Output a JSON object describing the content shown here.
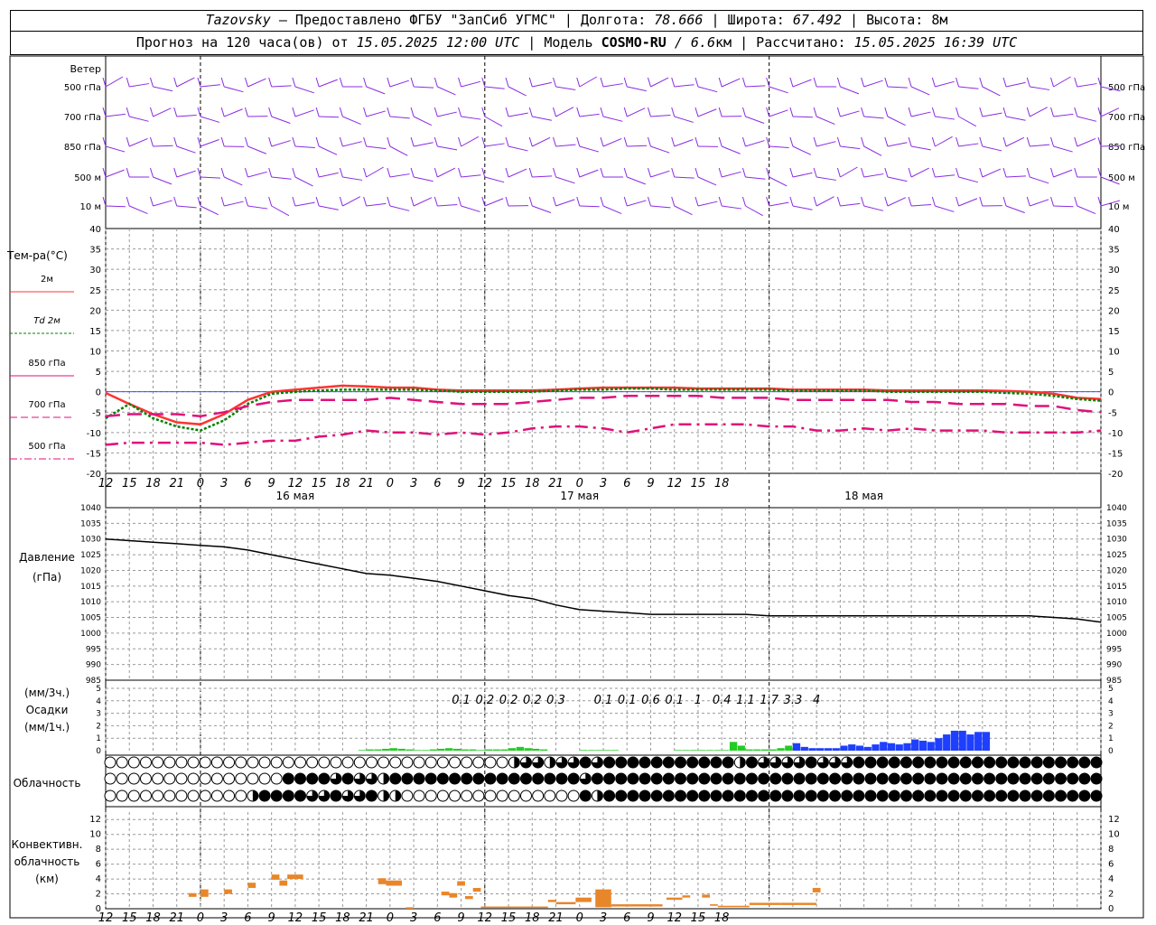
{
  "header": {
    "station": "Tazovsky",
    "provider": " — Предоставлено ФГБУ \"ЗапСиб УГМС\" | Долгота: ",
    "lon": "78.666",
    "lat_label": " | Широта: ",
    "lat": "67.492",
    "alt_label": " | Высота: 8м",
    "forecast_label": "Прогноз на 120 часа(ов) от ",
    "forecast_time": "15.05.2025 12:00 UTC",
    "model_label": "  | Модель ",
    "model": "COSMO-RU",
    "resolution": " / 6.6",
    "km": "км | Рассчитано: ",
    "calc_time": "15.05.2025 16:39 UTC"
  },
  "colors": {
    "wind": "#8a2be2",
    "t2m": "#ff3333",
    "td2m": "#008000",
    "t850": "#e0107a",
    "t700": "#e0107a",
    "t500": "#e0107a",
    "pressure": "#000000",
    "precip_light": "#22cc22",
    "precip_heavy": "#1f3fff",
    "conv": "#e8862a",
    "zero_line": "#3333ff"
  },
  "wind_panel": {
    "title": "Ветер",
    "levels": [
      "500 гПа",
      "700 гПа",
      "850 гПа",
      "500 м",
      "10 м"
    ]
  },
  "temp_panel": {
    "title": "Тем-ра(°C)",
    "legend": [
      {
        "label": "2м",
        "style": "solid"
      },
      {
        "label": "Td  2м",
        "style": "dotted"
      },
      {
        "label": "850 гПа",
        "style": "solid-thin"
      },
      {
        "label": "700 гПа",
        "style": "dashed"
      },
      {
        "label": "500 гПа",
        "style": "dashdot"
      }
    ]
  },
  "pressure_panel": {
    "title_line1": "Давление",
    "title_line2": "(гПа)"
  },
  "precip_panel": {
    "title_line1": "(мм/3ч.)",
    "title_line2": "Осадки",
    "title_line3": "(мм/1ч.)"
  },
  "cloud_panel": {
    "title": "Облачность"
  },
  "conv_panel": {
    "title_line1": "Конвективн.",
    "title_line2": "облачность",
    "title_line3": "(км)"
  },
  "chart_data": [
    {
      "type": "line",
      "title": "Тем-ра(°C)",
      "x_hours": [
        0,
        3,
        6,
        9,
        12,
        15,
        18,
        21,
        24,
        27,
        30,
        33,
        36,
        39,
        42,
        45,
        48,
        51,
        54,
        57,
        60,
        63,
        66,
        69,
        72,
        75,
        78,
        81,
        84,
        87,
        90,
        93,
        96,
        99,
        102,
        105,
        108,
        111,
        114,
        117,
        120,
        123,
        126
      ],
      "x_tick_labels": [
        "12",
        "15",
        "18",
        "21",
        "0",
        "3",
        "6",
        "9",
        "12",
        "15",
        "18",
        "21",
        "0",
        "3",
        "6",
        "9",
        "12",
        "15",
        "18",
        "21",
        "0",
        "3",
        "6",
        "9",
        "12",
        "15",
        "18"
      ],
      "day_labels": [
        "16 мая",
        "17 мая",
        "18 мая"
      ],
      "ylim": [
        -20,
        40
      ],
      "y_ticks": [
        -20,
        -15,
        -10,
        -5,
        0,
        5,
        10,
        15,
        20,
        25,
        30,
        35,
        40
      ],
      "series": [
        {
          "name": "2м",
          "values": [
            -0.3,
            -3,
            -5.5,
            -7.5,
            -8,
            -5.5,
            -2,
            0,
            0.5,
            1,
            1.5,
            1.3,
            1,
            1,
            0.5,
            0.3,
            0.3,
            0.3,
            0.3,
            0.5,
            0.8,
            1,
            1,
            1,
            1,
            0.8,
            0.8,
            0.8,
            0.8,
            0.5,
            0.5,
            0.5,
            0.5,
            0.3,
            0.3,
            0.3,
            0.3,
            0.3,
            0.2,
            0,
            -0.5,
            -1.5,
            -1.8
          ]
        },
        {
          "name": "Td  2м",
          "values": [
            -6.5,
            -3,
            -6.5,
            -8.5,
            -9.5,
            -7,
            -3,
            -0.5,
            0,
            0.3,
            0.5,
            0.5,
            0.5,
            0.5,
            0.3,
            0,
            0,
            0,
            0,
            0.3,
            0.5,
            0.5,
            0.8,
            0.8,
            0.5,
            0.5,
            0.5,
            0.5,
            0.5,
            0.3,
            0.3,
            0.3,
            0.3,
            0,
            0,
            0,
            0,
            0,
            -0.3,
            -0.5,
            -1,
            -1.8,
            -2.2
          ]
        },
        {
          "name": "700 гПа",
          "values": [
            -6,
            -5.5,
            -5.5,
            -5.5,
            -6,
            -5,
            -3.5,
            -2.5,
            -2,
            -2,
            -2,
            -2,
            -1.5,
            -2,
            -2.5,
            -3,
            -3,
            -3,
            -2.5,
            -2,
            -1.5,
            -1.5,
            -1,
            -1,
            -1,
            -1,
            -1.5,
            -1.5,
            -1.5,
            -2,
            -2,
            -2,
            -2,
            -2,
            -2.5,
            -2.5,
            -3,
            -3,
            -3,
            -3.5,
            -3.5,
            -4.5,
            -5
          ]
        },
        {
          "name": "500 гПа",
          "values": [
            -13,
            -12.5,
            -12.5,
            -12.5,
            -12.5,
            -13,
            -12.5,
            -12,
            -12,
            -11,
            -10.5,
            -9.5,
            -10,
            -10,
            -10.5,
            -10,
            -10.5,
            -10,
            -9,
            -8.5,
            -8.5,
            -9,
            -10,
            -9,
            -8,
            -8,
            -8,
            -8,
            -8.5,
            -8.5,
            -9.5,
            -9.5,
            -9,
            -9.5,
            -9,
            -9.5,
            -9.5,
            -9.5,
            -10,
            -10,
            -10,
            -10,
            -9.5
          ]
        }
      ]
    },
    {
      "type": "line",
      "title": "Давление",
      "ylabel": "(гПа)",
      "ylim": [
        985,
        1040
      ],
      "y_ticks": [
        985,
        990,
        995,
        1000,
        1005,
        1010,
        1015,
        1020,
        1025,
        1030,
        1035,
        1040
      ],
      "x_hours": [
        0,
        3,
        6,
        9,
        12,
        15,
        18,
        21,
        24,
        27,
        30,
        33,
        36,
        39,
        42,
        45,
        48,
        51,
        54,
        57,
        60,
        63,
        66,
        69,
        72,
        75,
        78,
        81,
        84,
        87,
        90,
        93,
        96,
        99,
        102,
        105,
        108,
        111,
        114,
        117,
        120,
        123,
        126
      ],
      "series": [
        {
          "name": "",
          "values": [
            1030,
            1029.5,
            1029,
            1028.5,
            1028,
            1027.5,
            1026.5,
            1025,
            1023.5,
            1022,
            1020.5,
            1019,
            1018.5,
            1017.5,
            1016.5,
            1015,
            1013.5,
            1012,
            1011,
            1009,
            1007.5,
            1007,
            1006.5,
            1006,
            1006,
            1006,
            1006,
            1006,
            1005.5,
            1005.5,
            1005.5,
            1005.5,
            1005.5,
            1005.5,
            1005.5,
            1005.5,
            1005.5,
            1005.5,
            1005.5,
            1005.5,
            1005,
            1004.5,
            1003.5
          ]
        }
      ]
    },
    {
      "type": "bar",
      "title": "Осадки",
      "ylabel": "(мм/1ч.)",
      "ylim": [
        0,
        5
      ],
      "y_ticks": [
        0,
        1,
        2,
        3,
        4,
        5
      ],
      "label_3h_hours": [
        45,
        48,
        51,
        54,
        57,
        60,
        63,
        66,
        69,
        72,
        75,
        78,
        81,
        84,
        87,
        90,
        93
      ],
      "label_3h": [
        "0.1",
        "0.2",
        "0.2",
        "0.2",
        "0.3",
        "0.1",
        "0.1",
        "0.6",
        "0.1",
        "1",
        "0.4",
        "1.1",
        "1.7",
        "3.3",
        "4"
      ],
      "label_3h_positions": [
        45,
        48,
        51,
        54,
        57,
        63,
        66,
        69,
        72,
        75,
        78,
        81,
        84,
        87,
        90
      ],
      "hourly_start_hour": 32,
      "hourly_values": [
        0.05,
        0.1,
        0.1,
        0.15,
        0.2,
        0.15,
        0.1,
        0.05,
        0.05,
        0.1,
        0.15,
        0.2,
        0.15,
        0.1,
        0.1,
        0.05,
        0.1,
        0.1,
        0.1,
        0.2,
        0.3,
        0.2,
        0.15,
        0.1,
        0,
        0,
        0,
        0,
        0.05,
        0.05,
        0.05,
        0.05,
        0.05,
        0,
        0,
        0,
        0,
        0,
        0,
        0,
        0.05,
        0.05,
        0.05,
        0.05,
        0.05,
        0.05,
        0.05,
        0.7,
        0.4,
        0.1,
        0.1,
        0.1,
        0.1,
        0.2,
        0.4,
        0.6,
        0.3,
        0.2,
        0.2,
        0.2,
        0.2,
        0.4,
        0.5,
        0.4,
        0.3,
        0.5,
        0.7,
        0.6,
        0.5,
        0.6,
        0.9,
        0.8,
        0.7,
        1,
        1.3,
        1.6,
        1.6,
        1.3,
        1.5,
        1.5
      ],
      "heavy_threshold_hour": 87
    },
    {
      "type": "table",
      "title": "Облачность",
      "rows": 3,
      "cols": 43,
      "cover_row_high": [
        0,
        0,
        0,
        0,
        0,
        0,
        0,
        0,
        0,
        0,
        0,
        0,
        0,
        0,
        0,
        0,
        0,
        0,
        0,
        0,
        0,
        0,
        0,
        0,
        0,
        0,
        0,
        0,
        0,
        0,
        0,
        0,
        0,
        0,
        2,
        3,
        3,
        2,
        3,
        3,
        4,
        3,
        4,
        4,
        4,
        4,
        4,
        4,
        4,
        4,
        4,
        4,
        4,
        2,
        4,
        3,
        3,
        3,
        3,
        4,
        3,
        3,
        3,
        4,
        4,
        4,
        4,
        4,
        4,
        4,
        4,
        4,
        4,
        4,
        4,
        4,
        4,
        4,
        4,
        4,
        4,
        4,
        4,
        4,
        4,
        4,
        4,
        4,
        4,
        4,
        4,
        4,
        4,
        4,
        4,
        4,
        4,
        4,
        4,
        4,
        4,
        4,
        4,
        4,
        4,
        4,
        4,
        4,
        4,
        4,
        4,
        4,
        4,
        4,
        4,
        4,
        4,
        4,
        4,
        4,
        4,
        4,
        4,
        4,
        4,
        4,
        4,
        4,
        4
      ],
      "cover_row_mid_note": "0=clear,1=1/4,2=1/2,3=3/4,4=overcast",
      "cover_row_mid": [
        0,
        0,
        0,
        0,
        0,
        0,
        0,
        0,
        0,
        0,
        0,
        0,
        0,
        0,
        0,
        4,
        4,
        4,
        4,
        3,
        4,
        3,
        3,
        2,
        4,
        4,
        4,
        4,
        4,
        4,
        4,
        4,
        4,
        4,
        4,
        4,
        4,
        4,
        4,
        4,
        3,
        4,
        4,
        4,
        4,
        4,
        4,
        4,
        4,
        4,
        4,
        4,
        4,
        4,
        4,
        4,
        4,
        4,
        4,
        4,
        4,
        4,
        4,
        4,
        4,
        4,
        4,
        4,
        4,
        4,
        4,
        4,
        4,
        4,
        4,
        4,
        4,
        4,
        4,
        4,
        4,
        4,
        4,
        4,
        4,
        4,
        4,
        4,
        4,
        4
      ],
      "cover_row_low": [
        0,
        0,
        0,
        0,
        0,
        0,
        0,
        0,
        0,
        0,
        0,
        0,
        2,
        4,
        4,
        4,
        4,
        3,
        3,
        4,
        3,
        3,
        4,
        2,
        2,
        0,
        0,
        0,
        0,
        0,
        0,
        0,
        0,
        0,
        0,
        0,
        0,
        0,
        0,
        0,
        4,
        2,
        4,
        4,
        4,
        4,
        4,
        4,
        4,
        4,
        4,
        4,
        4,
        4,
        4,
        4,
        4,
        4,
        4,
        4,
        4,
        4,
        4,
        4,
        4,
        4,
        4,
        4,
        4,
        4,
        4,
        4,
        4,
        4,
        4,
        4,
        4,
        4,
        4,
        4,
        4,
        4,
        4,
        4,
        4,
        4,
        4,
        4,
        4,
        4
      ]
    },
    {
      "type": "bar",
      "title": "Конвективн. облачность",
      "ylabel": "(км)",
      "ylim": [
        0,
        13
      ],
      "y_ticks": [
        0,
        2,
        4,
        6,
        8,
        10,
        12
      ],
      "segments": [
        {
          "start": 10.5,
          "end": 11.5,
          "base": 1.6,
          "top": 2.1
        },
        {
          "start": 12,
          "end": 13,
          "base": 1.6,
          "top": 2.6
        },
        {
          "start": 15,
          "end": 16,
          "base": 2,
          "top": 2.6
        },
        {
          "start": 18,
          "end": 19,
          "base": 2.8,
          "top": 3.5
        },
        {
          "start": 21,
          "end": 22,
          "base": 3.9,
          "top": 4.6
        },
        {
          "start": 22,
          "end": 23,
          "base": 3.1,
          "top": 3.8
        },
        {
          "start": 23,
          "end": 25,
          "base": 4,
          "top": 4.6
        },
        {
          "start": 34.5,
          "end": 35.5,
          "base": 3.3,
          "top": 4.1
        },
        {
          "start": 35.5,
          "end": 37.5,
          "base": 3.1,
          "top": 3.8
        },
        {
          "start": 38,
          "end": 39,
          "base": 0,
          "top": 0.2
        },
        {
          "start": 42.5,
          "end": 43.5,
          "base": 1.8,
          "top": 2.3
        },
        {
          "start": 43.5,
          "end": 44.5,
          "base": 1.5,
          "top": 2.1
        },
        {
          "start": 44.5,
          "end": 45.5,
          "base": 3.1,
          "top": 3.7
        },
        {
          "start": 45.5,
          "end": 46.5,
          "base": 1.3,
          "top": 1.7
        },
        {
          "start": 46.5,
          "end": 47.5,
          "base": 2.3,
          "top": 2.8
        },
        {
          "start": 47.5,
          "end": 56,
          "base": 0.1,
          "top": 0.3
        },
        {
          "start": 56,
          "end": 57,
          "base": 0.9,
          "top": 1.2
        },
        {
          "start": 57,
          "end": 59.5,
          "base": 0.6,
          "top": 0.9
        },
        {
          "start": 59.5,
          "end": 61.5,
          "base": 0.9,
          "top": 1.5
        },
        {
          "start": 62,
          "end": 64,
          "base": 0.2,
          "top": 2.6
        },
        {
          "start": 64,
          "end": 70.5,
          "base": 0.3,
          "top": 0.6
        },
        {
          "start": 71,
          "end": 73,
          "base": 1.2,
          "top": 1.5
        },
        {
          "start": 73,
          "end": 74,
          "base": 1.5,
          "top": 1.8
        },
        {
          "start": 75.5,
          "end": 76.5,
          "base": 1.5,
          "top": 1.9
        },
        {
          "start": 76.5,
          "end": 77.5,
          "base": 0.4,
          "top": 0.6
        },
        {
          "start": 77.5,
          "end": 81.5,
          "base": 0.2,
          "top": 0.4
        },
        {
          "start": 81.5,
          "end": 85.5,
          "base": 0.5,
          "top": 0.8
        },
        {
          "start": 85.5,
          "end": 90,
          "base": 0.5,
          "top": 0.8
        },
        {
          "start": 89.5,
          "end": 90.5,
          "base": 2.2,
          "top": 2.8
        }
      ]
    }
  ]
}
